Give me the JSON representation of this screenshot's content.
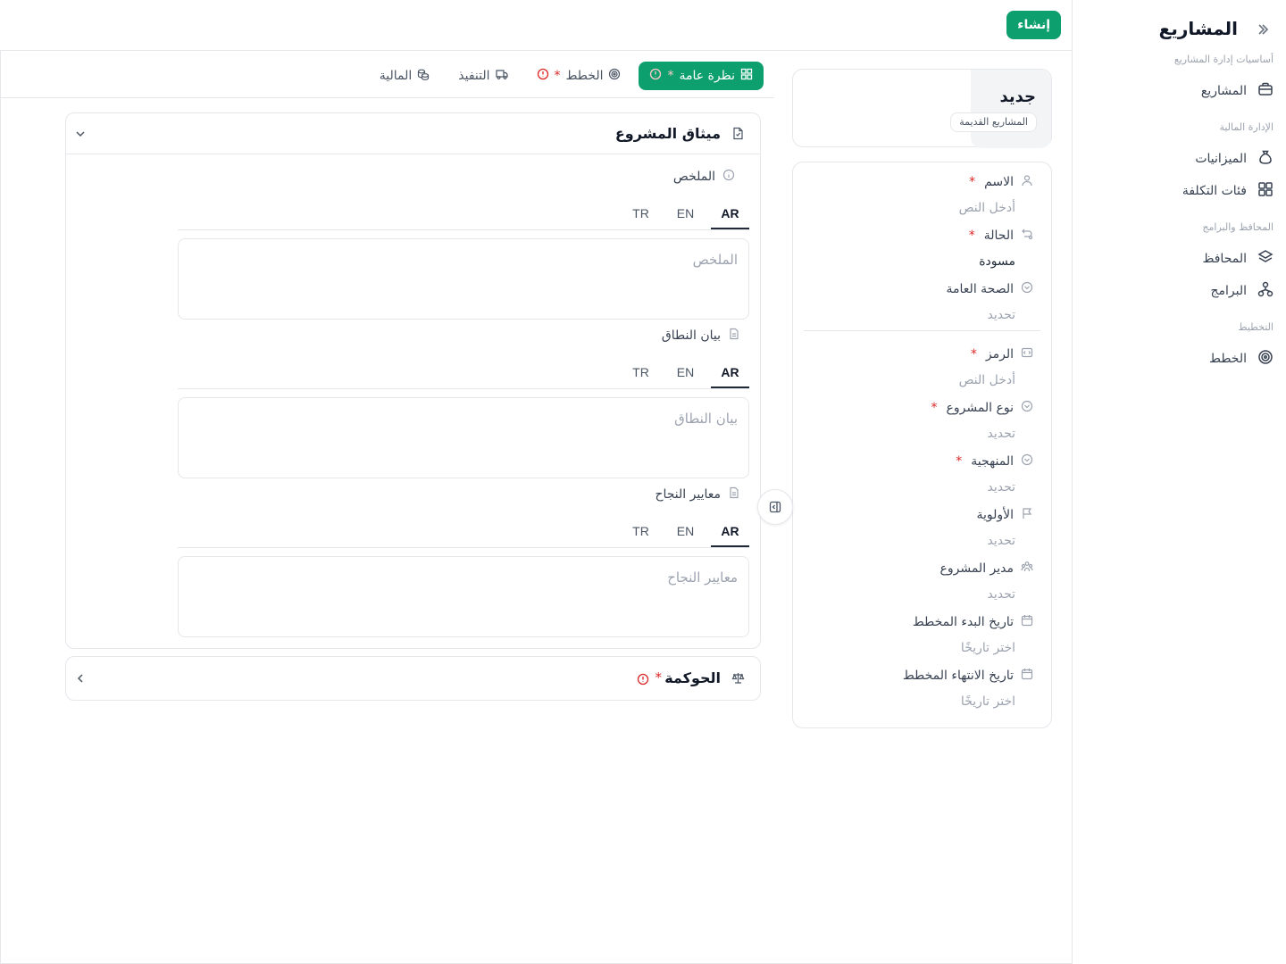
{
  "sidebar": {
    "title": "المشاريع",
    "groups": [
      "أساسيات إدارة المشاريع",
      "الإدارة المالية",
      "المحافظ والبرامج",
      "التخطيط"
    ],
    "items": [
      {
        "label": "المشاريع",
        "icon": "briefcase-icon"
      },
      {
        "label": "الميزانيات",
        "icon": "money-bag-icon"
      },
      {
        "label": "فئات التكلفة",
        "icon": "grid-icon"
      },
      {
        "label": "المحافظ",
        "icon": "layers-icon"
      },
      {
        "label": "البرامج",
        "icon": "hierarchy-icon"
      },
      {
        "label": "الخطط",
        "icon": "target-icon"
      }
    ]
  },
  "topbar": {
    "create_label": "إنشاء"
  },
  "header_card": {
    "title": "جديد",
    "badge": "المشاريع القديمة"
  },
  "fields": [
    {
      "label": "الاسم",
      "required": true,
      "value": "أدخل النص",
      "filled": false,
      "icon": "user-icon"
    },
    {
      "label": "الحالة",
      "required": true,
      "value": "مسودة",
      "filled": true,
      "icon": "status-icon"
    },
    {
      "label": "الصحة العامة",
      "required": false,
      "value": "تحديد",
      "filled": false,
      "icon": "circle-check-icon"
    },
    {
      "label": "الرمز",
      "required": true,
      "value": "أدخل النص",
      "filled": false,
      "icon": "code-icon"
    },
    {
      "label": "نوع المشروع",
      "required": true,
      "value": "تحديد",
      "filled": false,
      "icon": "circle-check-icon"
    },
    {
      "label": "المنهجية",
      "required": true,
      "value": "تحديد",
      "filled": false,
      "icon": "circle-check-icon"
    },
    {
      "label": "الأولوية",
      "required": false,
      "value": "تحديد",
      "filled": false,
      "icon": "flag-icon"
    },
    {
      "label": "مدير المشروع",
      "required": false,
      "value": "تحديد",
      "filled": false,
      "icon": "users-icon"
    },
    {
      "label": "تاريخ البدء المخطط",
      "required": false,
      "value": "اختر تاريخًا",
      "filled": false,
      "icon": "calendar-icon"
    },
    {
      "label": "تاريخ الانتهاء المخطط",
      "required": false,
      "value": "اختر تاريخًا",
      "filled": false,
      "icon": "calendar-icon"
    }
  ],
  "tabs": [
    {
      "label": "نظرة عامة",
      "active": true,
      "required": true,
      "alert": true,
      "icon": "dashboard-icon"
    },
    {
      "label": "الخطط",
      "active": false,
      "required": true,
      "alert": true,
      "icon": "target-icon"
    },
    {
      "label": "التنفيذ",
      "active": false,
      "required": false,
      "alert": false,
      "icon": "truck-icon"
    },
    {
      "label": "المالية",
      "active": false,
      "required": false,
      "alert": false,
      "icon": "coins-icon"
    }
  ],
  "charter": {
    "title": "ميثاق المشروع",
    "languages": [
      "AR",
      "EN",
      "TR"
    ],
    "sections": [
      {
        "label": "الملخص",
        "placeholder": "الملخص",
        "icon": "info-icon"
      },
      {
        "label": "بيان النطاق",
        "placeholder": "بيان النطاق",
        "icon": "document-icon"
      },
      {
        "label": "معايير النجاح",
        "placeholder": "معايير النجاح",
        "icon": "document-icon"
      }
    ]
  },
  "governance": {
    "title": "الحوكمة",
    "required_mark": "*"
  },
  "required_mark": "*",
  "colors": {
    "accent": "#0e9f6e",
    "required": "#dc2626",
    "border": "#e5e7eb"
  }
}
